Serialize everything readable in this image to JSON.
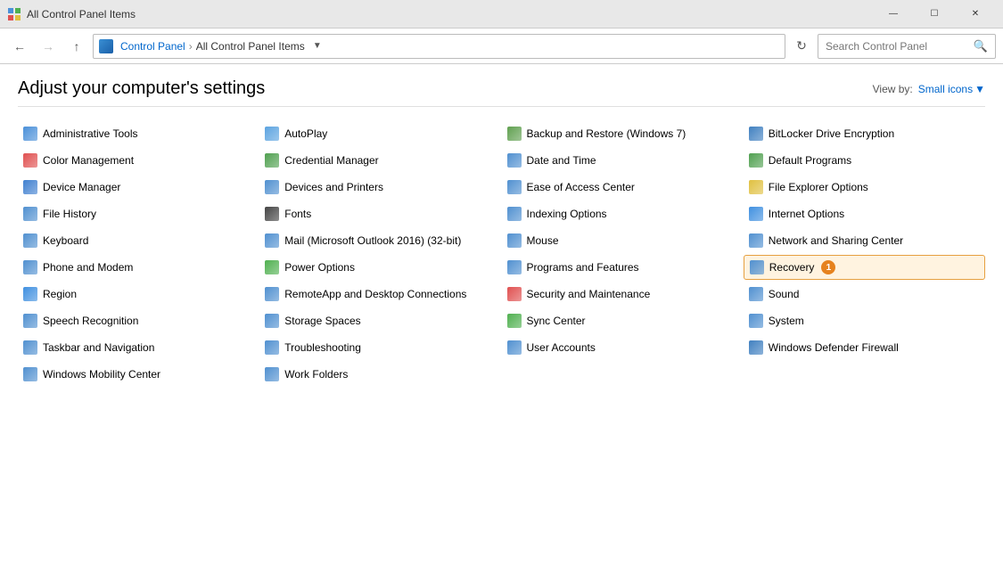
{
  "titleBar": {
    "title": "All Control Panel Items",
    "icon": "control-panel-icon"
  },
  "titleBarControls": {
    "minimize": "—",
    "maximize": "☐",
    "close": "✕"
  },
  "addressBar": {
    "back": "←",
    "forward": "→",
    "up": "↑",
    "breadcrumb": [
      {
        "label": "Control Panel"
      },
      {
        "label": "All Control Panel Items"
      }
    ],
    "dropdownArrow": "▾",
    "refresh": "⟳",
    "searchPlaceholder": "Search Control Panel",
    "searchIcon": "🔍"
  },
  "header": {
    "title": "Adjust your computer's settings",
    "viewBy": "View by:",
    "viewByValue": "Small icons"
  },
  "items": [
    {
      "label": "Administrative Tools",
      "col": 1
    },
    {
      "label": "AutoPlay",
      "col": 2
    },
    {
      "label": "Backup and Restore (Windows 7)",
      "col": 3
    },
    {
      "label": "BitLocker Drive Encryption",
      "col": 4
    },
    {
      "label": "Color Management",
      "col": 1
    },
    {
      "label": "Credential Manager",
      "col": 2
    },
    {
      "label": "Date and Time",
      "col": 3
    },
    {
      "label": "Default Programs",
      "col": 4
    },
    {
      "label": "Device Manager",
      "col": 1
    },
    {
      "label": "Devices and Printers",
      "col": 2
    },
    {
      "label": "Ease of Access Center",
      "col": 3
    },
    {
      "label": "File Explorer Options",
      "col": 4
    },
    {
      "label": "File History",
      "col": 1
    },
    {
      "label": "Fonts",
      "col": 2
    },
    {
      "label": "Indexing Options",
      "col": 3
    },
    {
      "label": "Internet Options",
      "col": 4
    },
    {
      "label": "Keyboard",
      "col": 1
    },
    {
      "label": "Mail (Microsoft Outlook 2016) (32-bit)",
      "col": 2
    },
    {
      "label": "Mouse",
      "col": 3
    },
    {
      "label": "Network and Sharing Center",
      "col": 4
    },
    {
      "label": "Phone and Modem",
      "col": 1
    },
    {
      "label": "Power Options",
      "col": 2
    },
    {
      "label": "Programs and Features",
      "col": 3
    },
    {
      "label": "Recovery",
      "col": 4,
      "highlighted": true,
      "badge": "1"
    },
    {
      "label": "Region",
      "col": 1
    },
    {
      "label": "RemoteApp and Desktop Connections",
      "col": 2
    },
    {
      "label": "Security and Maintenance",
      "col": 3
    },
    {
      "label": "Sound",
      "col": 4
    },
    {
      "label": "Speech Recognition",
      "col": 1
    },
    {
      "label": "Storage Spaces",
      "col": 2
    },
    {
      "label": "Sync Center",
      "col": 3
    },
    {
      "label": "System",
      "col": 4
    },
    {
      "label": "Taskbar and Navigation",
      "col": 1
    },
    {
      "label": "Troubleshooting",
      "col": 2
    },
    {
      "label": "User Accounts",
      "col": 3
    },
    {
      "label": "Windows Defender Firewall",
      "col": 4
    },
    {
      "label": "Windows Mobility Center",
      "col": 1
    },
    {
      "label": "Work Folders",
      "col": 2
    }
  ],
  "iconColors": {
    "Administrative Tools": "#4a90d9",
    "AutoPlay": "#5ba3e0",
    "Backup and Restore (Windows 7)": "#60a050",
    "BitLocker Drive Encryption": "#4080c0",
    "Color Management": "#e05050",
    "Credential Manager": "#50a050",
    "Date and Time": "#5090d0",
    "Default Programs": "#50a050",
    "Device Manager": "#4080d0",
    "Devices and Printers": "#5090d0",
    "Ease of Access Center": "#5090d0",
    "File Explorer Options": "#e0c040",
    "File History": "#5090d0",
    "Fonts": "#444444",
    "Indexing Options": "#5090d0",
    "Internet Options": "#4090e0",
    "Keyboard": "#5090d0",
    "Mail (Microsoft Outlook 2016) (32-bit)": "#5090d0",
    "Mouse": "#5090d0",
    "Network and Sharing Center": "#5090d0",
    "Phone and Modem": "#5090d0",
    "Power Options": "#50b050",
    "Programs and Features": "#5090d0",
    "Recovery": "#5090d0",
    "Region": "#4090e0",
    "RemoteApp and Desktop Connections": "#5090d0",
    "Security and Maintenance": "#e05050",
    "Sound": "#5090d0",
    "Speech Recognition": "#5090d0",
    "Storage Spaces": "#5090d0",
    "Sync Center": "#50b050",
    "System": "#5090d0",
    "Taskbar and Navigation": "#5090d0",
    "Troubleshooting": "#5090d0",
    "User Accounts": "#5090d0",
    "Windows Defender Firewall": "#4080c0",
    "Windows Mobility Center": "#5090d0",
    "Work Folders": "#5090d0"
  }
}
